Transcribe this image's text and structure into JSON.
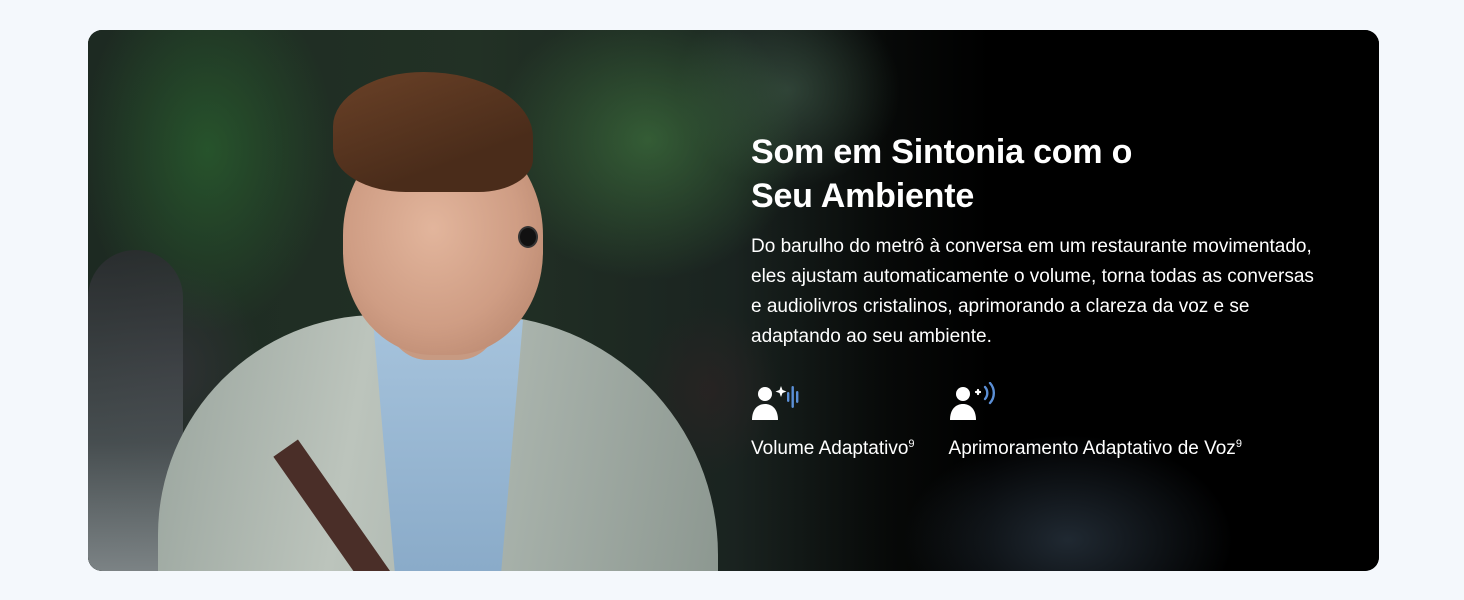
{
  "banner": {
    "headline_line1": "Som em Sintonia com o",
    "headline_line2": "Seu Ambiente",
    "body": "Do barulho do metrô à conversa em um restaurante movimentado, eles ajustam automaticamente o volume, torna todas as conversas e audiolivros cristalinos, aprimorando a clareza da voz e se adaptando ao seu ambiente."
  },
  "features": [
    {
      "icon": "person-sparkle-volume-icon",
      "label": "Volume Adaptativo",
      "footnote": "9"
    },
    {
      "icon": "person-sound-waves-icon",
      "label": "Aprimoramento Adaptativo de Voz",
      "footnote": "9"
    }
  ],
  "colors": {
    "page_background": "#f4f8fc",
    "banner_background": "#000000",
    "text": "#ffffff",
    "icon_accent": "#5b8fd6"
  }
}
